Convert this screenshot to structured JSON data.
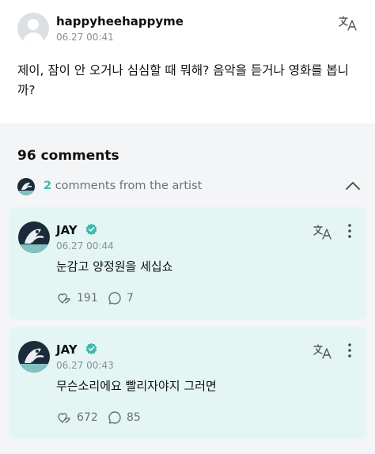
{
  "post": {
    "username": "happyheehappyme",
    "timestamp": "06.27 00:41",
    "text": "제이, 잠이 안 오거나 심심할 때 뭐해? 음악을 듣거나 영화를 봅니까?"
  },
  "comments_section": {
    "count_label": "96 comments",
    "artist_count": "2",
    "artist_label": " comments from the artist"
  },
  "comments": [
    {
      "author": "JAY",
      "timestamp": "06.27 00:44",
      "text": "눈감고 양정원을 세십쇼",
      "likes": "191",
      "replies": "7"
    },
    {
      "author": "JAY",
      "timestamp": "06.27 00:43",
      "text": "무슨소리에요 빨리자야지 그러면",
      "likes": "672",
      "replies": "85"
    }
  ],
  "colors": {
    "accent": "#3fb8ad",
    "card_background": "#e3f6f4",
    "verified": "#3fb8ad"
  },
  "icons": [
    "translate-icon",
    "chevron-up-icon",
    "more-icon",
    "verified-badge-icon",
    "like-icon",
    "reply-icon"
  ]
}
